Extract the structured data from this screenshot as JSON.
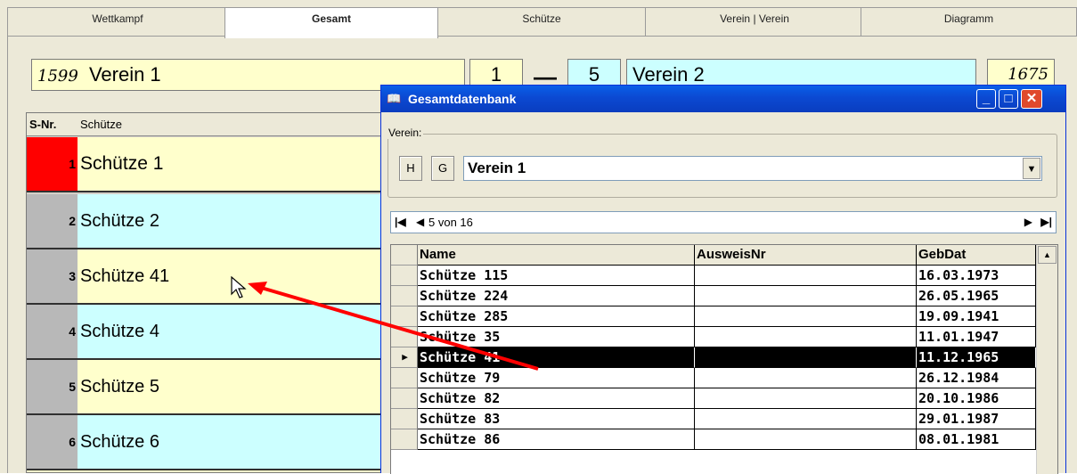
{
  "tabs": [
    "Wettkampf",
    "Gesamt",
    "Schütze",
    "Verein | Verein",
    "Diagramm"
  ],
  "active_tab": "Gesamt",
  "scoreboard": {
    "left_score": "1599",
    "left_team": "Verein 1",
    "left_result": "1",
    "separator": "—",
    "right_result": "5",
    "right_team": "Verein 2",
    "right_score": "1675"
  },
  "shooter_list": {
    "col_num": "S-Nr.",
    "col_name": "Schütze",
    "rows": [
      {
        "num": "1",
        "name": "Schütze  1"
      },
      {
        "num": "2",
        "name": "Schütze 2"
      },
      {
        "num": "3",
        "name": "Schütze  41"
      },
      {
        "num": "4",
        "name": "Schütze 4"
      },
      {
        "num": "5",
        "name": "Schütze 5"
      },
      {
        "num": "6",
        "name": "Schütze 6"
      }
    ],
    "colors": {
      "first_num": "#ff0000",
      "yellow": "#ffffcc",
      "cyan": "#ccffff"
    }
  },
  "dialog": {
    "title": "Gesamtdatenbank",
    "group_label": "Verein:",
    "btn_h": "H",
    "btn_g": "G",
    "verein_value": "Verein 1",
    "nav_text": "5 von 16",
    "columns": [
      "Name",
      "AusweisNr",
      "GebDat"
    ],
    "rows": [
      {
        "name": "Schütze 115",
        "ausweis": "",
        "geb": "16.03.1973"
      },
      {
        "name": "Schütze 224",
        "ausweis": "",
        "geb": "26.05.1965"
      },
      {
        "name": "Schütze 285",
        "ausweis": "",
        "geb": "19.09.1941"
      },
      {
        "name": "Schütze 35",
        "ausweis": "",
        "geb": "11.01.1947"
      },
      {
        "name": "Schütze 41",
        "ausweis": "",
        "geb": "11.12.1965"
      },
      {
        "name": "Schütze 79",
        "ausweis": "",
        "geb": "26.12.1984"
      },
      {
        "name": "Schütze 82",
        "ausweis": "",
        "geb": "20.10.1986"
      },
      {
        "name": "Schütze 83",
        "ausweis": "",
        "geb": "29.01.1987"
      },
      {
        "name": "Schütze 86",
        "ausweis": "",
        "geb": "08.01.1981"
      }
    ],
    "selected_row": 4
  },
  "annotation_color": "#ff0000"
}
